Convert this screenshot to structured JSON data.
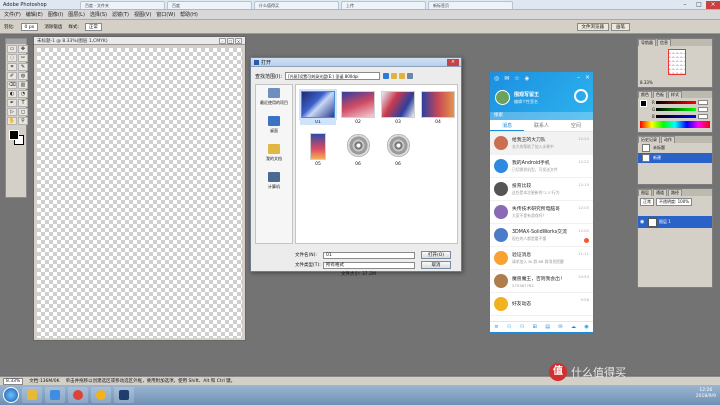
{
  "browser": {
    "ps_title": "Adobe Photoshop",
    "tabs": [
      "百度 - 文件夹",
      "百度",
      "什么值得买",
      "上传",
      "新标签页"
    ]
  },
  "menubar": [
    "文件(F)",
    "编辑(E)",
    "图像(I)",
    "图层(L)",
    "选择(S)",
    "滤镜(T)",
    "视图(V)",
    "窗口(W)",
    "帮助(H)"
  ],
  "options": {
    "feather_label": "羽化:",
    "feather_value": "0 px",
    "antialias_label": "消除锯齿",
    "style_label": "样式:",
    "style_value": "正常",
    "right_tabs": [
      "文件浏览器",
      "画笔"
    ]
  },
  "document": {
    "title": "未标题-1 @ 8.33%(图层 1,CMYK)"
  },
  "open_dialog": {
    "title": "打开",
    "look_in_label": "查找范围(I):",
    "look_in_value": "[光驱]设置可刻录光盘(E:) 圣诞 800dpi",
    "places": [
      "最近使用的项目",
      "桌面",
      "我的文档",
      "计算机"
    ],
    "files": [
      {
        "name": "01",
        "kind": "art1",
        "selected": true
      },
      {
        "name": "02",
        "kind": "art2",
        "selected": false
      },
      {
        "name": "03",
        "kind": "art3",
        "selected": false
      },
      {
        "name": "04",
        "kind": "art4",
        "selected": false
      },
      {
        "name": "05",
        "kind": "art5",
        "selected": false
      },
      {
        "name": "06",
        "kind": "disc",
        "selected": false
      },
      {
        "name": "06",
        "kind": "disc",
        "selected": false
      }
    ],
    "filename_label": "文件名(N):",
    "filename_value": "01",
    "filetype_label": "文件类型(T):",
    "filetype_value": "所有格式",
    "open_button": "打开(O)",
    "cancel_button": "取消",
    "file_size": "文件大小: 37.2M"
  },
  "qq": {
    "nickname": "围观写留王",
    "signature": "编辑个性签名",
    "search_placeholder": "搜索",
    "tabs": [
      "消息",
      "联系人",
      "空间"
    ],
    "active_tab": 0,
    "conversations": [
      {
        "name": "给我王的大刀队",
        "msg": "长大的帮助了加入水果中",
        "time": "12:24",
        "color": "#c96f52",
        "active": true
      },
      {
        "name": "我的Android手机",
        "msg": "已切换到机型，可发送文件",
        "time": "12:22",
        "color": "#2d8ae0",
        "active": false
      },
      {
        "name": "投育比较",
        "msg": "这些是本次更新的\"1.1\"行为",
        "time": "12:15",
        "color": "#555555",
        "active": false
      },
      {
        "name": "失传技术研究所电脑哥",
        "msg": "大家不是有游戏吗？",
        "time": "12:03",
        "color": "#8a6ab5",
        "active": false
      },
      {
        "name": "3DMAX-SolidWorks交流",
        "msg": "现在的人都是看不懂",
        "time": "12:02",
        "color": "#4c7cc9",
        "active": false
      },
      {
        "name": "验证消息",
        "msg": "请求加入 BI 群 BB 群消息提醒",
        "time": "11:11",
        "color": "#f7a233",
        "active": false
      },
      {
        "name": "魔兽魔王，否则我会出！",
        "msg": "275367762",
        "time": "10:54",
        "color": "#b07d4c",
        "active": false
      },
      {
        "name": "好友动态",
        "msg": "",
        "time": "9:58",
        "color": "#f1b21f",
        "active": false
      }
    ]
  },
  "panels": {
    "nav_tabs": [
      "导航器",
      "信息"
    ],
    "nav_zoom": "8.33%",
    "color_tabs": [
      "颜色",
      "色板",
      "样式"
    ],
    "color_channels": [
      "R",
      "G",
      "B"
    ],
    "history_tabs": [
      "历史记录",
      "动作"
    ],
    "history_items": [
      "未标题",
      "新建"
    ],
    "layers_tabs": [
      "图层",
      "通道",
      "路径"
    ],
    "blend_mode": "正常",
    "opacity": "不透明度: 100%",
    "layer_name": "图层 1"
  },
  "status": {
    "zoom": "8.33%",
    "doc_size": "文档:136M/0K",
    "hint": "单击并拖移以创建选区或移动选区外框，要用附加选项，使用 Shift、Alt 和 Ctrl 键。"
  },
  "taskbar": {
    "time": "12:26",
    "date": "2018/9/9"
  },
  "watermark": {
    "logo_char": "值",
    "text": "什么值得买"
  }
}
